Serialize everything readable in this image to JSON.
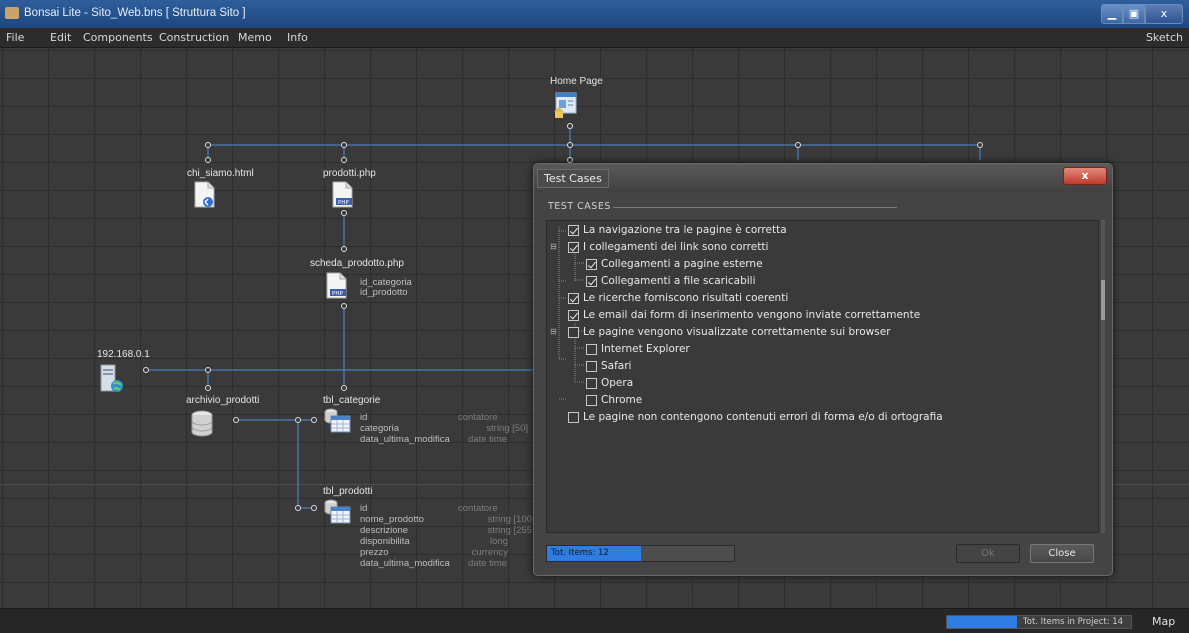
{
  "window": {
    "title": "Bonsai Lite  - Sito_Web.bns  [ Struttura Sito ]",
    "min_label": "▁",
    "max_label": "▣",
    "close_label": "x"
  },
  "menu": {
    "items": [
      "File",
      "Edit",
      "Components",
      "Construction",
      "Memo",
      "Info"
    ],
    "right_label": "Sketch"
  },
  "diagram": {
    "home": {
      "label": "Home Page"
    },
    "chi_siamo": {
      "label": "chi_siamo.html"
    },
    "prodotti": {
      "label": "prodotti.php"
    },
    "scheda": {
      "label": "scheda_prodotto.php",
      "params": [
        "id_categoria",
        "id_prodotto"
      ]
    },
    "server": {
      "label": "192.168.0.1"
    },
    "archivio": {
      "label": "archivio_prodotti"
    },
    "tbl_categorie": {
      "label": "tbl_categorie",
      "fields": [
        {
          "name": "id",
          "type": "contatore"
        },
        {
          "name": "categoria",
          "type": "string [50]"
        },
        {
          "name": "data_ultima_modifica",
          "type": "date time"
        }
      ]
    },
    "tbl_prodotti": {
      "label": "tbl_prodotti",
      "fields": [
        {
          "name": "id",
          "type": "contatore"
        },
        {
          "name": "nome_prodotto",
          "type": "string [100"
        },
        {
          "name": "descrizione",
          "type": "string [255"
        },
        {
          "name": "disponibilita",
          "type": "long"
        },
        {
          "name": "prezzo",
          "type": "currency"
        },
        {
          "name": "data_ultima_modifica",
          "type": "date time"
        }
      ]
    }
  },
  "status": {
    "progress_label": "Tot. Items in Project: 14",
    "progress_fraction": 0.38,
    "map_label": "Map"
  },
  "dialog": {
    "title": "Test Cases",
    "close_label": "x",
    "section_label": "TEST CASES",
    "items": [
      {
        "label": "La navigazione tra le pagine è corretta",
        "checked": true
      },
      {
        "label": "I collegamenti dei link sono corretti",
        "checked": true
      },
      {
        "label": "Collegamenti a pagine esterne",
        "checked": true
      },
      {
        "label": "Collegamenti a file scaricabili",
        "checked": true
      },
      {
        "label": "Le ricerche forniscono risultati coerenti",
        "checked": true
      },
      {
        "label": "Le email dai form di inserimento vengono inviate correttamente",
        "checked": true
      },
      {
        "label": "Le pagine vengono visualizzate correttamente sui browser",
        "checked": false
      },
      {
        "label": "Internet Explorer",
        "checked": false
      },
      {
        "label": "Safari",
        "checked": false
      },
      {
        "label": "Opera",
        "checked": false
      },
      {
        "label": "Chrome",
        "checked": false
      },
      {
        "label": "Le pagine non contengono contenuti errori di forma e/o di ortografia",
        "checked": false
      }
    ],
    "footer": {
      "progress_label": "Tot. Items: 12",
      "progress_fraction": 0.5,
      "ok_label": "Ok",
      "close_label": "Close"
    }
  }
}
